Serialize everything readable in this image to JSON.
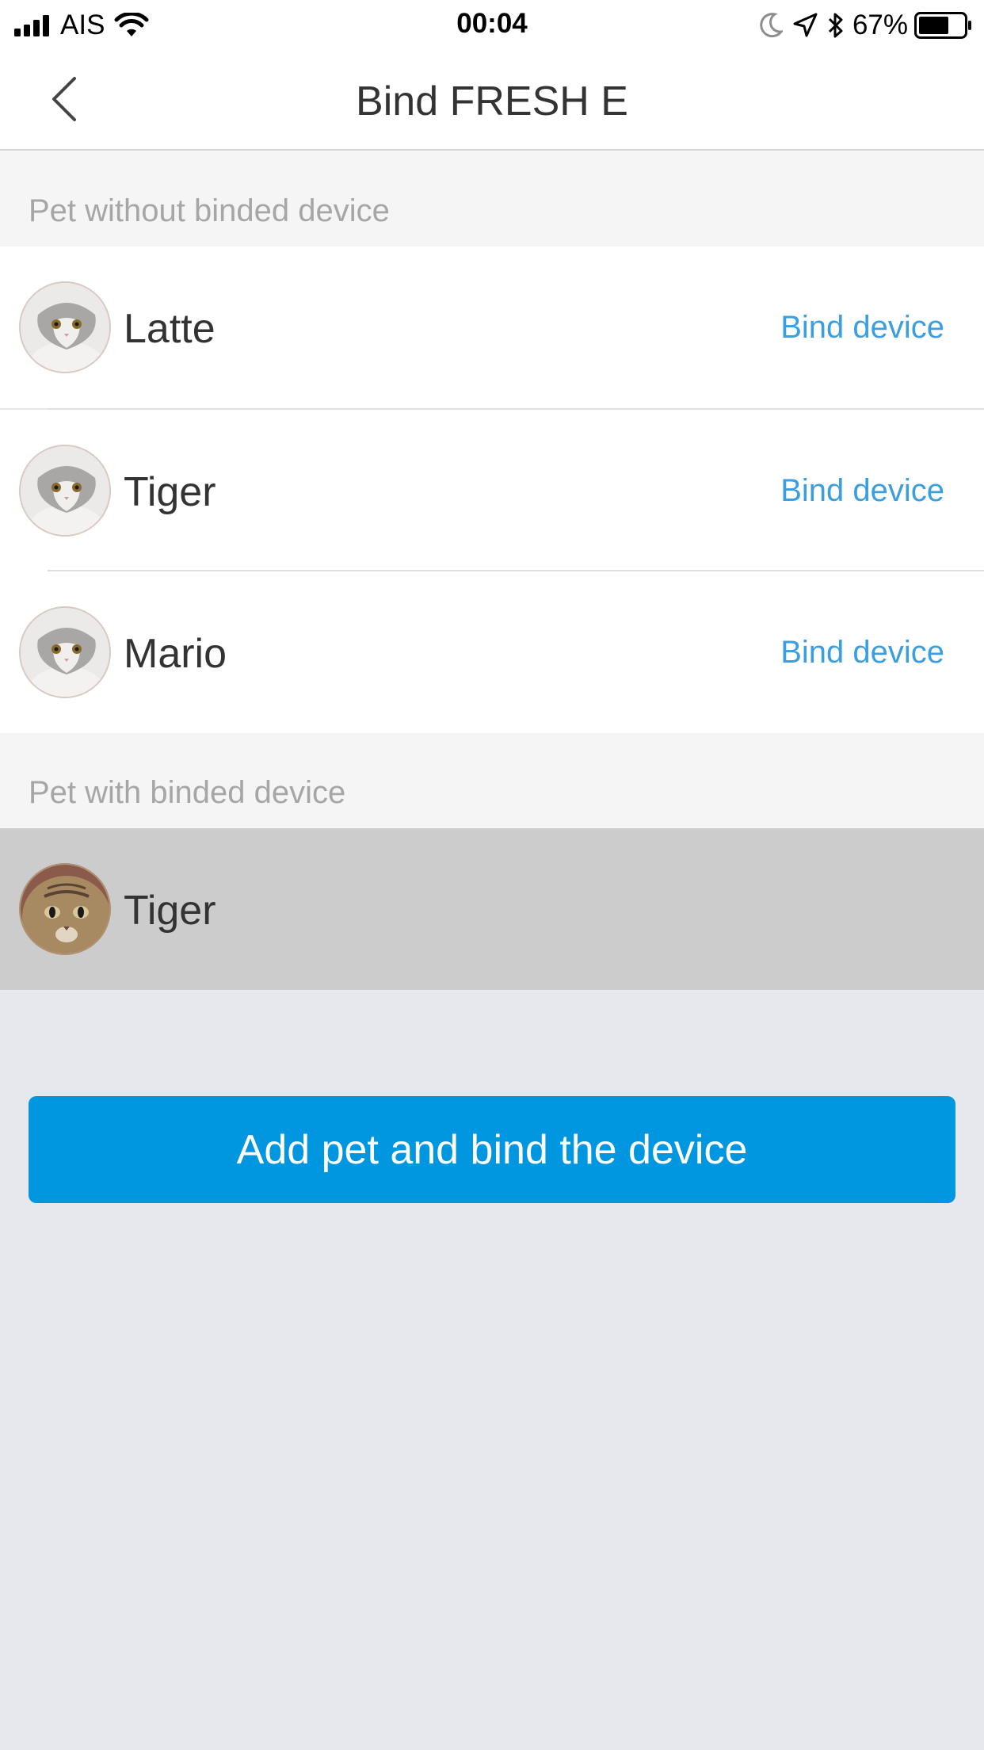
{
  "status_bar": {
    "carrier": "AIS",
    "time": "00:04",
    "battery_percent": "67%",
    "battery_level": 0.67,
    "icons": [
      "signal-icon",
      "wifi-icon",
      "moon-icon",
      "location-arrow-icon",
      "bluetooth-icon",
      "battery-icon"
    ]
  },
  "header": {
    "title": "Bind FRESH E",
    "back_icon": "chevron-left-icon"
  },
  "sections": {
    "unbound_title": "Pet without binded device",
    "bound_title": "Pet with binded device"
  },
  "unbound_pets": [
    {
      "name": "Latte",
      "action": "Bind device"
    },
    {
      "name": "Tiger",
      "action": "Bind device"
    },
    {
      "name": "Mario",
      "action": "Bind device"
    }
  ],
  "bound_pets": [
    {
      "name": "Tiger"
    }
  ],
  "footer": {
    "button_label": "Add pet and bind the device"
  },
  "colors": {
    "accent": "#0096e0",
    "link": "#3a9ee0",
    "background": "#e6e8ed",
    "section_bg": "#f5f5f5",
    "bound_row_bg": "#cccccc"
  }
}
